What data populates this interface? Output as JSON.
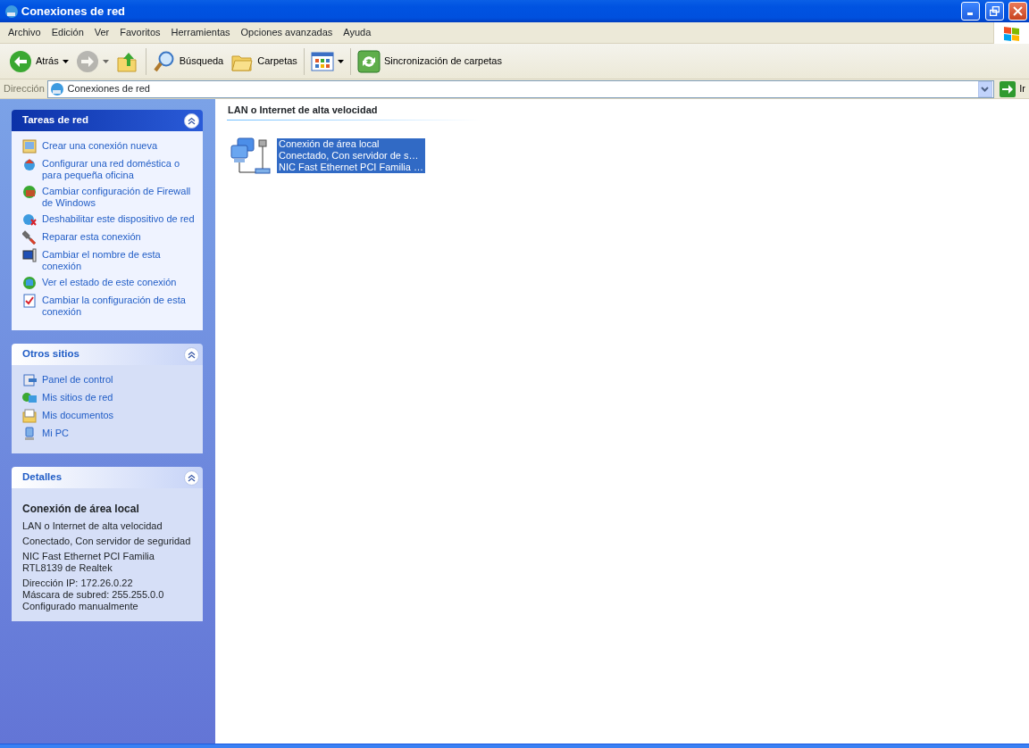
{
  "window": {
    "title": "Conexiones de red"
  },
  "menu": [
    "Archivo",
    "Edición",
    "Ver",
    "Favoritos",
    "Herramientas",
    "Opciones avanzadas",
    "Ayuda"
  ],
  "toolbar": [
    {
      "kind": "back",
      "label": "Atrás",
      "disabled": false,
      "dropdown": true
    },
    {
      "kind": "forward",
      "disabled": true,
      "dropdown": true
    },
    {
      "kind": "up",
      "disabled": false,
      "dropdown": false
    },
    {
      "kind": "search",
      "label": "Búsqueda",
      "disabled": false,
      "dropdown": false
    },
    {
      "kind": "folders",
      "label": "Carpetas",
      "disabled": false,
      "dropdown": false
    },
    {
      "kind": "views",
      "disabled": false,
      "dropdown": true
    },
    {
      "kind": "sync",
      "label": "Sincronización de carpetas",
      "disabled": false,
      "dropdown": false
    }
  ],
  "address": {
    "label": "Dirección",
    "value": "Conexiones de red",
    "go_label": "Ir"
  },
  "sidebar": {
    "panels": [
      {
        "title": "Tareas de red",
        "kind": "links",
        "items": [
          "Crear una conexión nueva",
          "Configurar una red doméstica o para pequeña oficina",
          "Cambiar configuración de Firewall de Windows",
          "Deshabilitar este dispositivo de red",
          "Reparar esta conexión",
          "Cambiar el nombre de esta conexión",
          "Ver el estado de este conexión",
          "Cambiar la configuración de esta conexión"
        ]
      },
      {
        "title": "Otros sitios",
        "kind": "links",
        "items": [
          "Panel de control",
          "Mis sitios de red",
          "Mis documentos",
          "Mi PC"
        ]
      },
      {
        "title": "Detalles",
        "kind": "details",
        "name": "Conexión de área local",
        "groups": [
          [
            "LAN o Internet de alta velocidad"
          ],
          [
            "Conectado, Con servidor de seguridad"
          ],
          [
            "NIC Fast Ethernet PCI Familia RTL8139 de Realtek"
          ],
          [
            "Dirección IP: 172.26.0.22",
            "Máscara de subred: 255.255.0.0",
            "Configurado manualmente"
          ]
        ]
      }
    ]
  },
  "content": {
    "groups": [
      {
        "title": "LAN o Internet de alta velocidad",
        "items": [
          {
            "lines": [
              "Conexión de área local",
              "Conectado, Con servidor de s…",
              "NIC Fast Ethernet PCI Familia …"
            ],
            "selected": true
          }
        ]
      }
    ]
  }
}
